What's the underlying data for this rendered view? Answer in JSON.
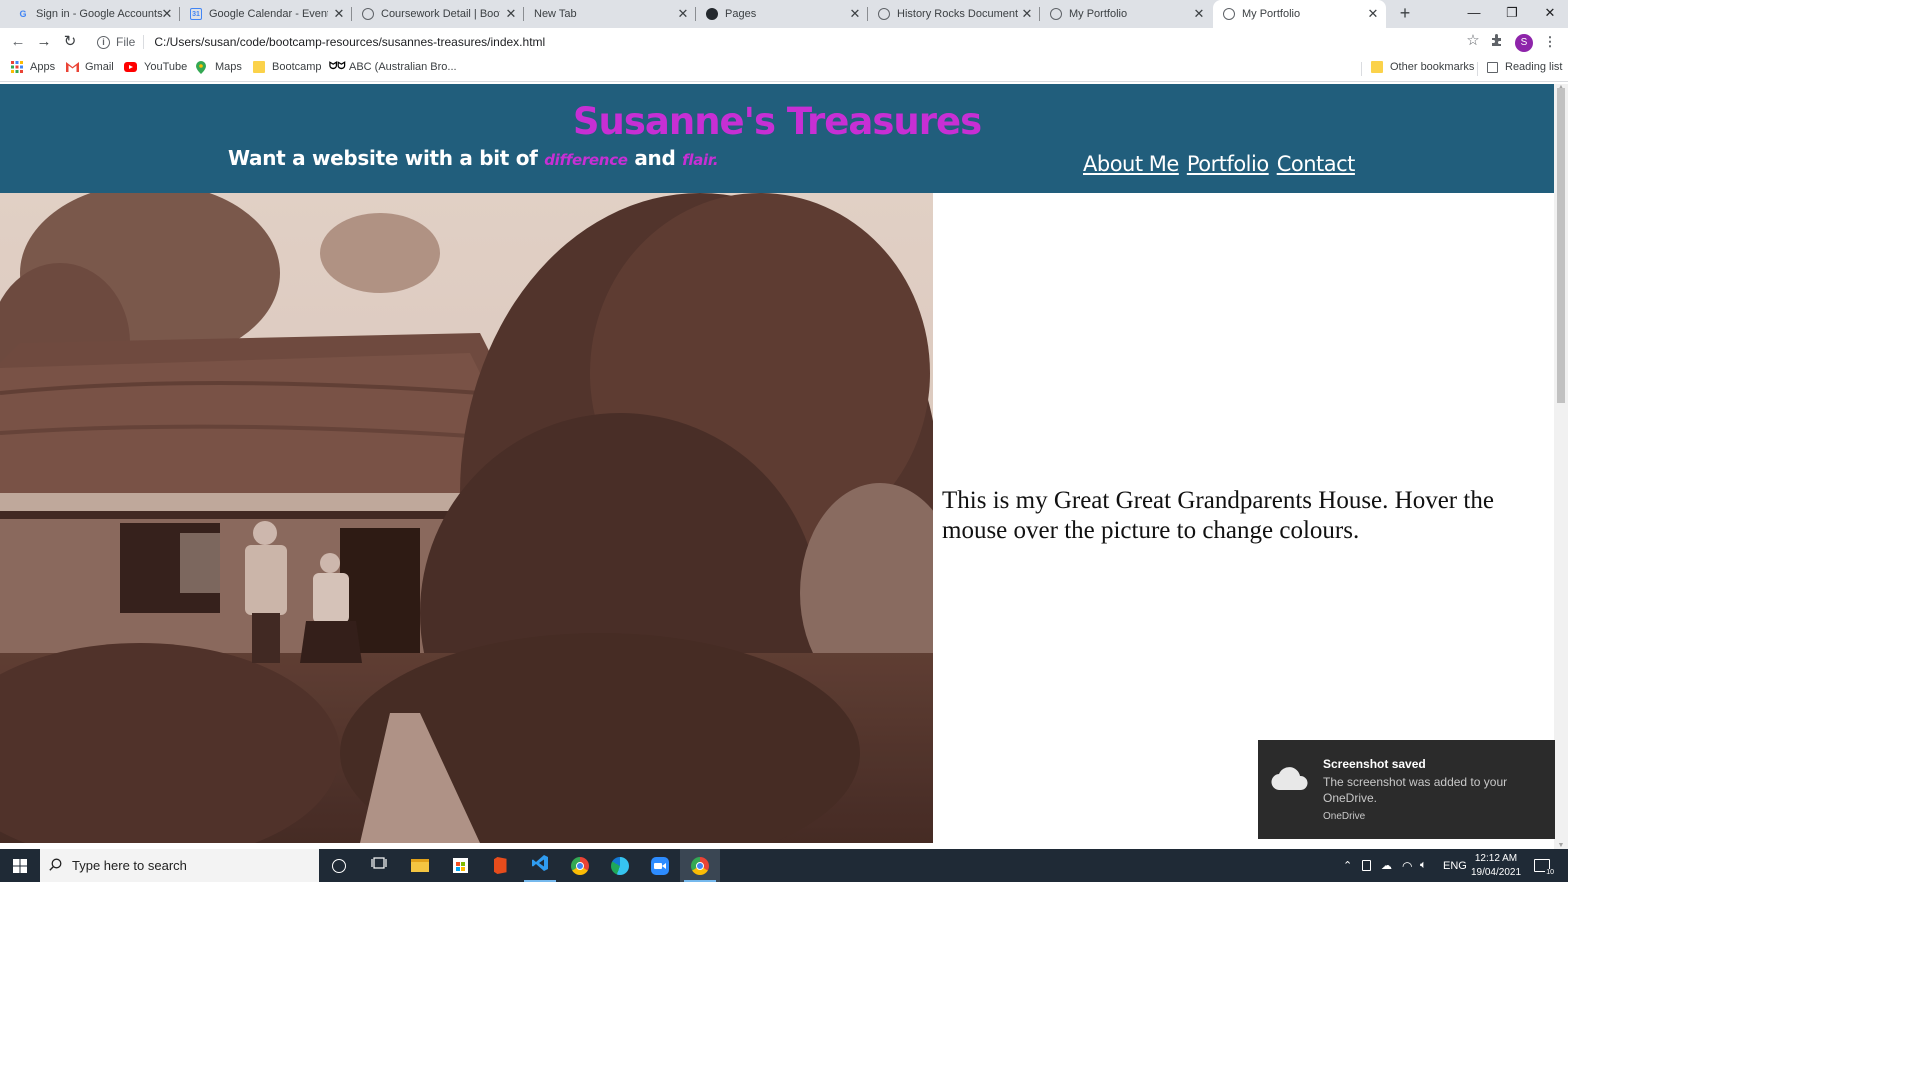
{
  "browser": {
    "tabs": [
      {
        "title": "Sign in - Google Accounts",
        "icon": "google-icon"
      },
      {
        "title": "Google Calendar - Event de",
        "icon": "calendar-icon"
      },
      {
        "title": "Coursework Detail | Bootca",
        "icon": "globe-icon"
      },
      {
        "title": "New Tab",
        "icon": ""
      },
      {
        "title": "Pages",
        "icon": "github-icon"
      },
      {
        "title": "History Rocks Document",
        "icon": "globe-icon"
      },
      {
        "title": "My Portfolio",
        "icon": "globe-icon"
      },
      {
        "title": "My Portfolio",
        "icon": "globe-icon",
        "active": true
      }
    ],
    "address": {
      "scheme_label": "File",
      "url": "C:/Users/susan/code/bootcamp-resources/susannes-treasures/index.html"
    },
    "profile_initial": "S",
    "bookmarks": [
      {
        "label": "Apps",
        "icon": "apps-grid-icon"
      },
      {
        "label": "Gmail",
        "icon": "gmail-icon"
      },
      {
        "label": "YouTube",
        "icon": "youtube-icon"
      },
      {
        "label": "Maps",
        "icon": "maps-pin-icon"
      },
      {
        "label": "Bootcamp",
        "icon": "folder-icon"
      },
      {
        "label": "ABC (Australian Bro...",
        "icon": "abc-icon"
      }
    ],
    "other_bookmarks": "Other bookmarks",
    "reading_list": "Reading list"
  },
  "site": {
    "title": "Susanne's Treasures",
    "tagline_prefix": "Want a website with a bit of ",
    "tagline_accent1": "difference",
    "tagline_mid": " and ",
    "tagline_accent2": "flair.",
    "nav": [
      "About Me",
      "Portfolio",
      "Contact"
    ],
    "caption": "This is my Great Great Grandparents House. Hover the mouse over the picture to change colours.",
    "colors": {
      "header_bg": "#215e7c",
      "accent": "#c72fd4"
    }
  },
  "toast": {
    "title": "Screenshot saved",
    "body": "The screenshot was added to your OneDrive.",
    "app": "OneDrive"
  },
  "taskbar": {
    "search_placeholder": "Type here to search",
    "language": "ENG",
    "time": "12:12 AM",
    "date": "19/04/2021",
    "notification_count": "10"
  }
}
